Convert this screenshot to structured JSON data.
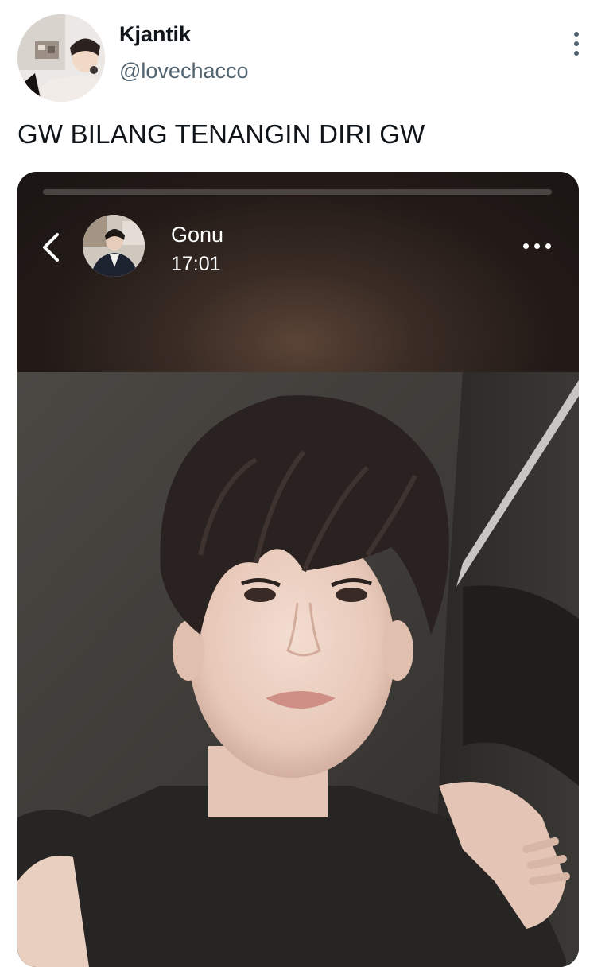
{
  "tweet": {
    "display_name": "Kjantik",
    "handle": "@lovechacco",
    "text": "GW BILANG TENANGIN DIRI GW"
  },
  "story": {
    "name": "Gonu",
    "time": "17:01"
  },
  "icons": {
    "more": "more-vertical-icon",
    "back": "chevron-left-icon",
    "story_more": "more-horizontal-icon"
  },
  "colors": {
    "text_primary": "#0f1419",
    "text_secondary": "#536471",
    "story_header": "#221a17"
  }
}
